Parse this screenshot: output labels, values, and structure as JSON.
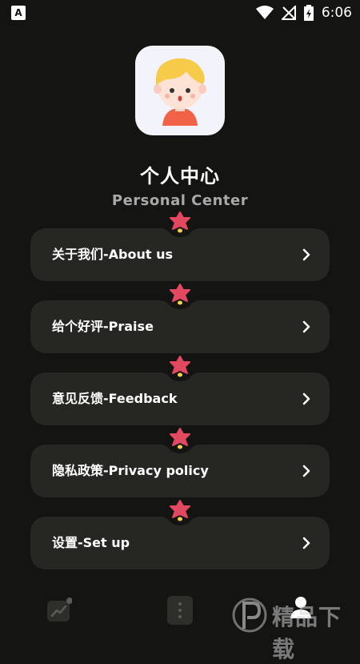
{
  "status_bar": {
    "time": "6:06"
  },
  "header": {
    "title": "个人中心",
    "subtitle": "Personal Center"
  },
  "menu": [
    {
      "label": "关于我们-About us"
    },
    {
      "label": "给个好评-Praise"
    },
    {
      "label": "意见反馈-Feedback"
    },
    {
      "label": "隐私政策-Privacy policy"
    },
    {
      "label": "设置-Set up"
    }
  ],
  "bottom_nav": {
    "items": [
      {
        "icon": "chart-icon"
      },
      {
        "icon": "menu-dots-icon"
      },
      {
        "icon": "person-icon",
        "active": true
      }
    ]
  },
  "watermark": {
    "text": "精品下载"
  },
  "colors": {
    "background": "#141412",
    "card": "#262623",
    "flower": "#e24860",
    "subtitle": "#a9a9a9"
  }
}
